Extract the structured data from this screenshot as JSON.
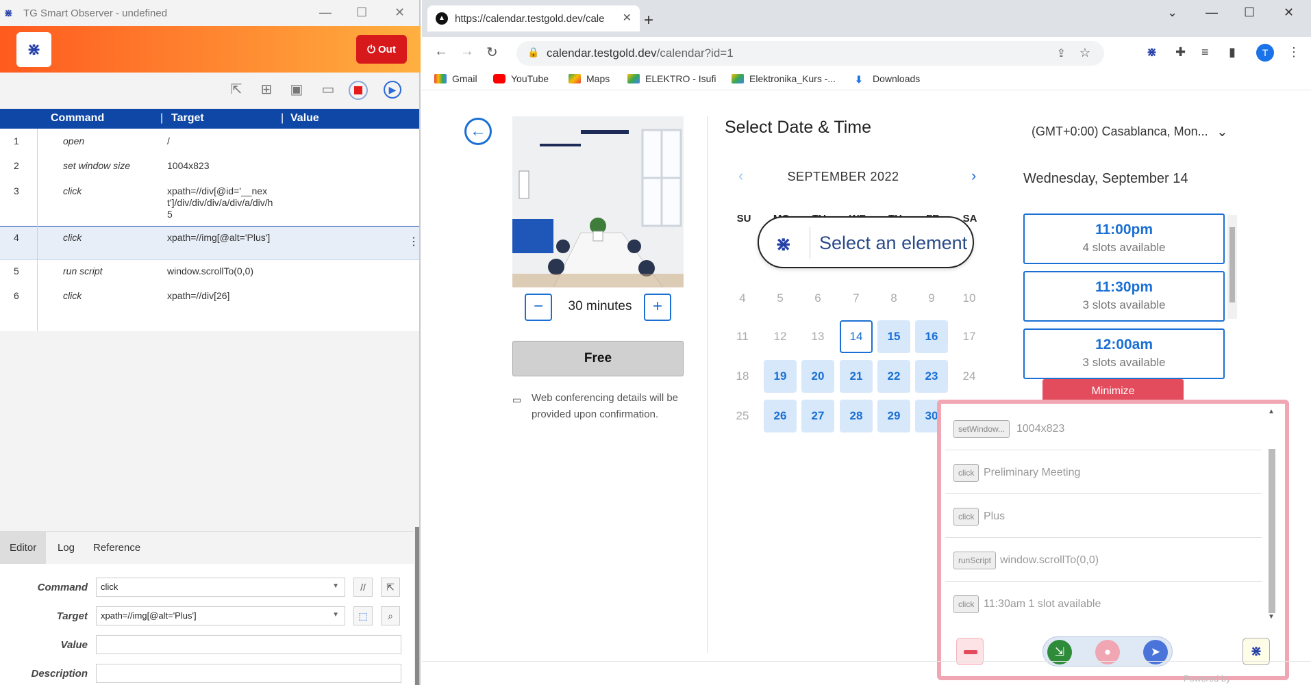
{
  "observer": {
    "title": "TG Smart Observer - undefined",
    "logo_glyph": "⋇",
    "out_label": "Out",
    "columns": {
      "command": "Command",
      "target": "Target",
      "value": "Value"
    },
    "commands": [
      {
        "n": "1",
        "cmd": "open",
        "target": "/"
      },
      {
        "n": "2",
        "cmd": "set window size",
        "target": "1004x823"
      },
      {
        "n": "3",
        "cmd": "click",
        "target": "xpath=//div[@id='__next']/div/div/div/a/div/a/div/h5"
      },
      {
        "n": "4",
        "cmd": "click",
        "target": "xpath=//img[@alt='Plus']"
      },
      {
        "n": "5",
        "cmd": "run script",
        "target": "window.scrollTo(0,0)"
      },
      {
        "n": "6",
        "cmd": "click",
        "target": "xpath=//div[26]"
      }
    ],
    "tabs": [
      "Editor",
      "Log",
      "Reference"
    ],
    "editor": {
      "command_label": "Command",
      "command_value": "click",
      "target_label": "Target",
      "target_value": "xpath=//img[@alt='Plus']",
      "value_label": "Value",
      "value_value": "",
      "description_label": "Description",
      "description_value": ""
    }
  },
  "browser": {
    "tab_title": "https://calendar.testgold.dev/cale",
    "url_host": "calendar.testgold.dev",
    "url_path": "/calendar?id=1",
    "avatar_letter": "T",
    "bookmarks": [
      "Gmail",
      "YouTube",
      "Maps",
      "ELEKTRO - Isufi",
      "Elektronika_Kurs -...",
      "Downloads"
    ]
  },
  "booking": {
    "duration": "30 minutes",
    "free_label": "Free",
    "conference_note": "Web conferencing details will be\nprovided upon confirmation.",
    "heading": "Select Date & Time",
    "timezone": "(GMT+0:00) Casablanca, Mon...",
    "month": "SEPTEMBER 2022",
    "weekdays": [
      "SU",
      "MO",
      "TU",
      "WE",
      "TH",
      "FR",
      "SA"
    ],
    "selected_date": "Wednesday, September 14",
    "slots": [
      {
        "time": "11:00pm",
        "avail": "4 slots available"
      },
      {
        "time": "11:30pm",
        "avail": "3 slots available"
      },
      {
        "time": "12:00am",
        "avail": "3 slots available"
      }
    ]
  },
  "overlay": {
    "select_text": "Select an element",
    "minimize_label": "Minimize",
    "recorded": [
      {
        "badge": "setWindow...",
        "label": "1004x823"
      },
      {
        "badge": "click",
        "label": "Preliminary Meeting"
      },
      {
        "badge": "click",
        "label": "Plus"
      },
      {
        "badge": "runScript",
        "label": "window.scrollTo(0,0)"
      },
      {
        "badge": "click",
        "label": "11:30am 1 slot available"
      }
    ],
    "powered": "Powered by"
  }
}
